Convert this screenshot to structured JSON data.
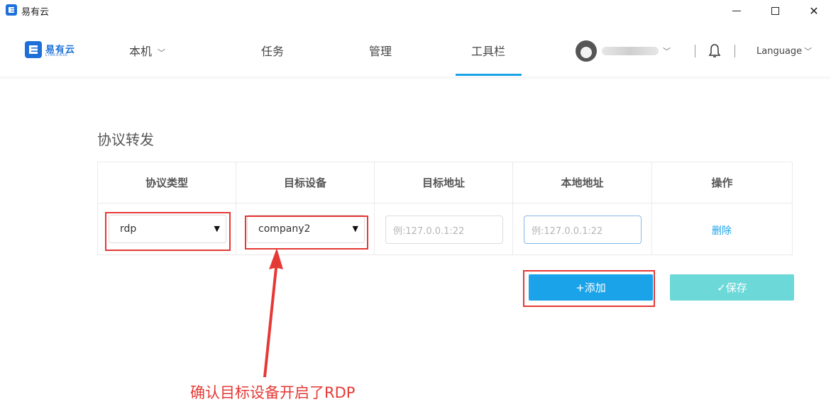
{
  "window": {
    "title": "易有云",
    "minimize_label": "",
    "maximize_label": "",
    "close_label": "✕"
  },
  "logo": {
    "text": "易有云",
    "subtext": "LINKEASE"
  },
  "nav": {
    "local": "本机",
    "task": "任务",
    "manage": "管理",
    "toolbar": "工具栏",
    "language": "Language",
    "active_tab": "工具栏"
  },
  "section": {
    "title": "协议转发"
  },
  "table": {
    "headers": [
      "协议类型",
      "目标设备",
      "目标地址",
      "本地地址",
      "操作"
    ],
    "row": {
      "protocol": "rdp",
      "device": "company2",
      "target_placeholder": "例:127.0.0.1:22",
      "local_placeholder": "例:127.0.0.1:22",
      "action": "删除"
    }
  },
  "buttons": {
    "add": "+添加",
    "save": "✓保存"
  },
  "annotation": {
    "text": "确认目标设备开启了RDP"
  },
  "colors": {
    "accent": "#1aa3e8",
    "save_button": "#6dd8d8",
    "annotation_red": "#e53935",
    "logo_blue": "#1e6fd9"
  },
  "icons": {
    "app": "app-logo-icon",
    "bell": "bell-icon",
    "chevron": "chevron-down-icon",
    "dropdown_arrow": "caret-down-icon"
  }
}
